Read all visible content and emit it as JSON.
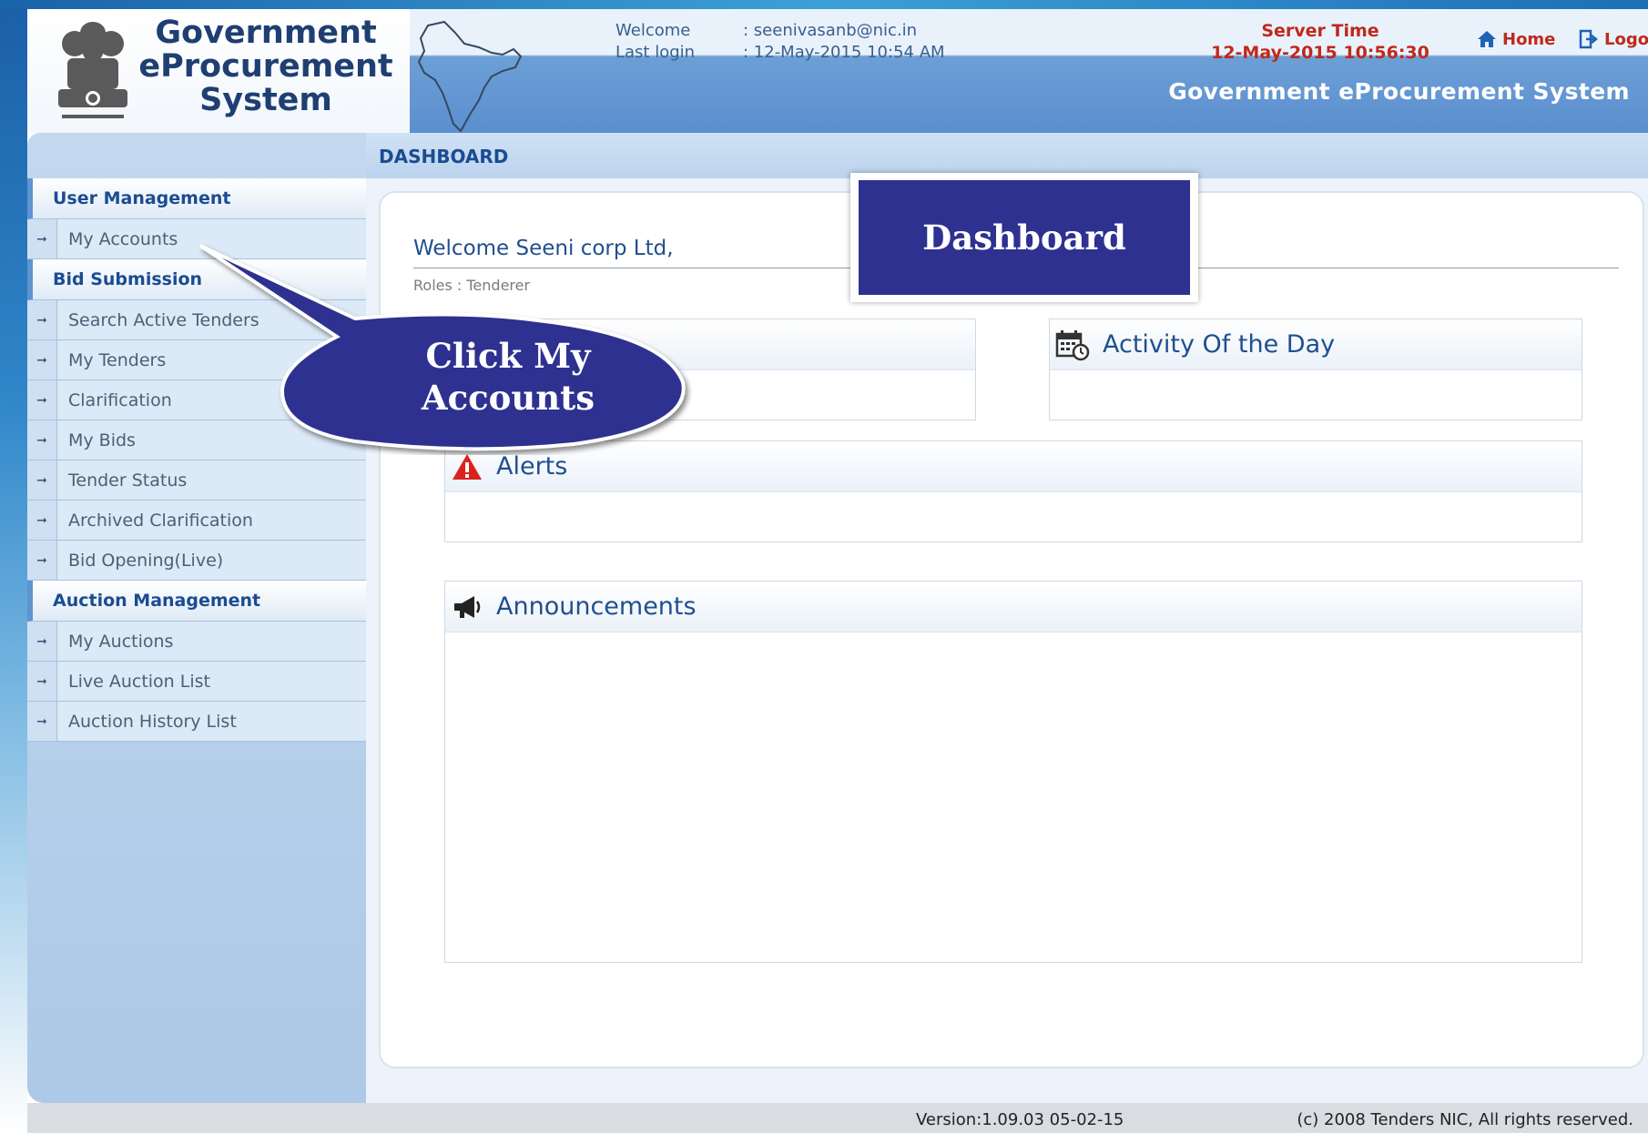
{
  "app": {
    "logo_lines": [
      "Government",
      "eProcurement",
      "System"
    ],
    "system_title": "Government eProcurement System"
  },
  "session": {
    "welcome_label": "Welcome",
    "welcome_value": ": seenivasanb@nic.in",
    "last_login_label": "Last login",
    "last_login_value": ": 12-May-2015 10:54 AM",
    "server_time_label": "Server Time",
    "server_time_value": "12-May-2015 10:56:30"
  },
  "nav": {
    "home": "Home",
    "logout": "Logout"
  },
  "sidebar": {
    "sections": [
      {
        "title": "User Management",
        "items": [
          "My Accounts"
        ]
      },
      {
        "title": "Bid Submission",
        "items": [
          "Search Active Tenders",
          "My Tenders",
          "Clarification",
          "My Bids",
          "Tender Status",
          "Archived Clarification",
          "Bid Opening(Live)"
        ]
      },
      {
        "title": "Auction Management",
        "items": [
          "My Auctions",
          "Live Auction List",
          "Auction History List"
        ]
      }
    ]
  },
  "main": {
    "header": "DASHBOARD",
    "welcome": "Welcome Seeni corp Ltd,",
    "roles": "Roles : Tenderer",
    "activity_title": "Activity Of the Day",
    "alerts_title": "Alerts",
    "announcements_title": "Announcements"
  },
  "footer": {
    "version": "Version:1.09.03 05-02-15",
    "copyright": "(c) 2008 Tenders NIC, All rights reserved."
  },
  "annotations": {
    "dashboard_callout": "Dashboard",
    "click_callout_lines": [
      "Click My",
      "Accounts"
    ]
  },
  "colors": {
    "accent_red": "#c0281c",
    "header_blue": "#5b8fcf",
    "callout_navy": "#2e3190",
    "link_blue": "#1a4c92"
  }
}
